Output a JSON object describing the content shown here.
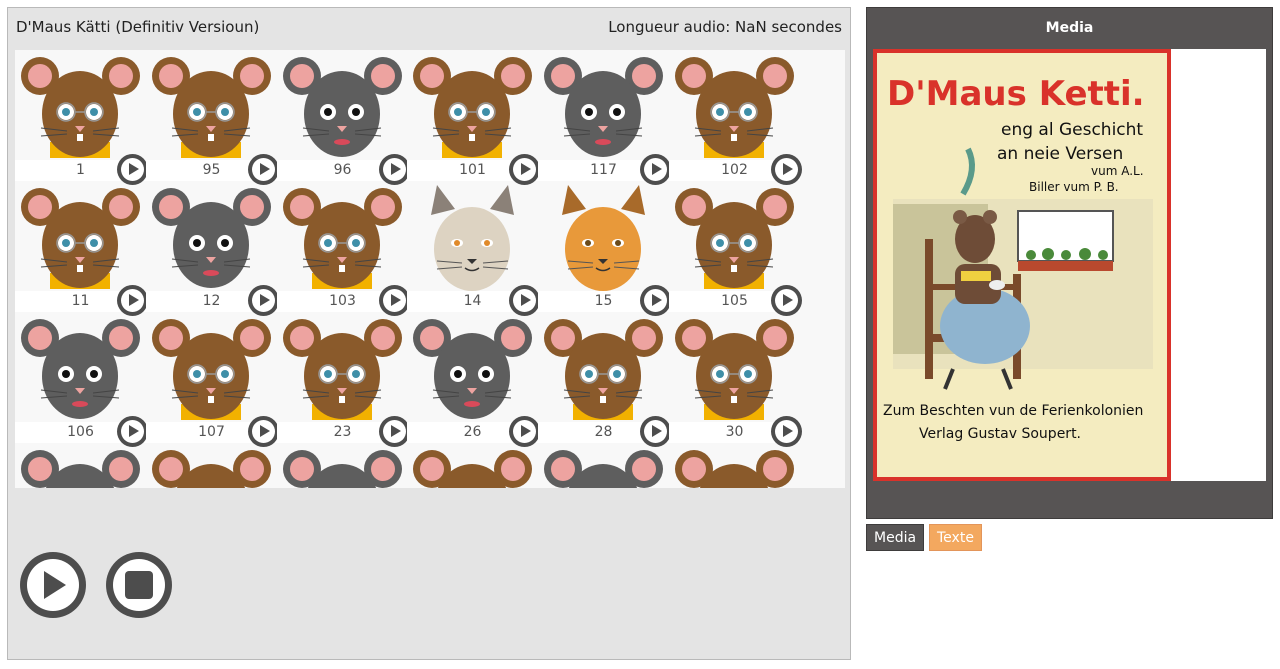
{
  "document": {
    "title": "D'Maus Kätti (Definitiv Versioun)",
    "audio_length": "Longueur audio: NaN secondes"
  },
  "grid": {
    "rows": [
      [
        {
          "n": "1",
          "kind": "mouse-brown"
        },
        {
          "n": "95",
          "kind": "mouse-brown"
        },
        {
          "n": "96",
          "kind": "mouse-gray"
        },
        {
          "n": "101",
          "kind": "mouse-brown"
        },
        {
          "n": "117",
          "kind": "mouse-gray"
        },
        {
          "n": "102",
          "kind": "mouse-brown"
        }
      ],
      [
        {
          "n": "11",
          "kind": "mouse-brown"
        },
        {
          "n": "12",
          "kind": "mouse-gray"
        },
        {
          "n": "103",
          "kind": "mouse-brown"
        },
        {
          "n": "14",
          "kind": "cat-gray"
        },
        {
          "n": "15",
          "kind": "cat-orange"
        },
        {
          "n": "105",
          "kind": "mouse-brown"
        }
      ],
      [
        {
          "n": "106",
          "kind": "mouse-gray"
        },
        {
          "n": "107",
          "kind": "mouse-brown"
        },
        {
          "n": "23",
          "kind": "mouse-brown"
        },
        {
          "n": "26",
          "kind": "mouse-gray"
        },
        {
          "n": "28",
          "kind": "mouse-brown"
        },
        {
          "n": "30",
          "kind": "mouse-brown"
        }
      ],
      [
        {
          "n": "",
          "kind": "mouse-gray"
        },
        {
          "n": "",
          "kind": "mouse-brown"
        },
        {
          "n": "",
          "kind": "mouse-gray"
        },
        {
          "n": "",
          "kind": "mouse-brown"
        },
        {
          "n": "",
          "kind": "mouse-gray"
        },
        {
          "n": "",
          "kind": "mouse-brown"
        }
      ]
    ],
    "play_icon": "play-icon"
  },
  "controls": {
    "play_icon": "play-icon",
    "stop_icon": "stop-icon"
  },
  "media": {
    "title": "Media",
    "cover": {
      "line1": "D'Maus Ketti.",
      "line2": "eng al Geschicht",
      "line3": "an neie Versen",
      "line4": "vum A.L.",
      "line5": "Biller vum P. B.",
      "line6": "Zum Beschten vun de Ferienkolonien",
      "line7": "Verlag Gustav Soupert."
    }
  },
  "tabs": {
    "media": "Media",
    "texte": "Texte"
  },
  "colors": {
    "panel_gray": "#e4e4e4",
    "media_dark": "#575454",
    "tab_orange": "#f3a85f",
    "mouse_brown": "#8a5a2b",
    "mouse_gray": "#5e5e5e",
    "ear_pink": "#eda3a0",
    "cover_red": "#d9322a",
    "cover_bg": "#f4ecc0"
  }
}
